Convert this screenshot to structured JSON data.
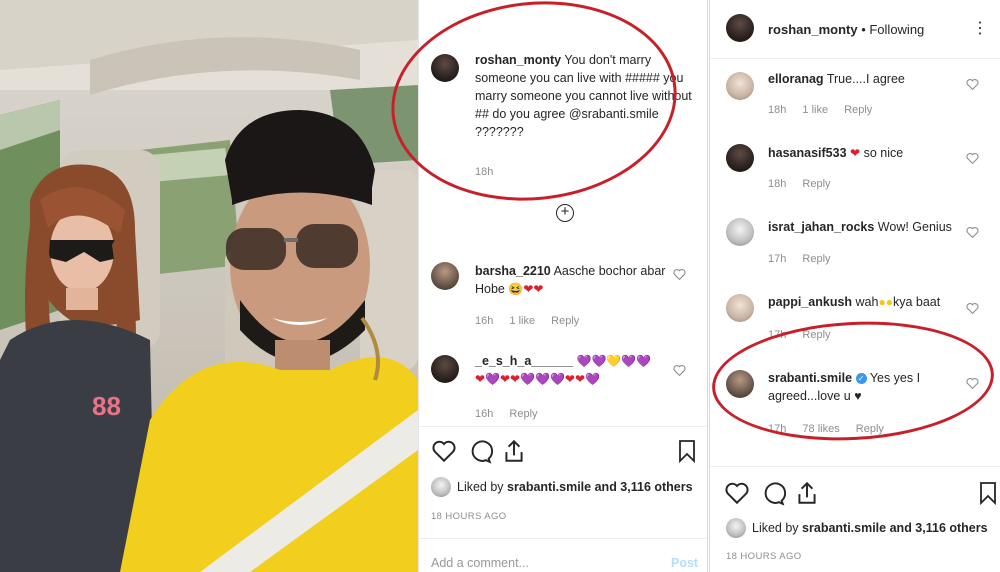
{
  "middle": {
    "top_comment": {
      "username": "roshan_monty",
      "text": "You don't marry someone you can live with ##### you marry someone you cannot live without ## do you agree",
      "mention": "@srabanti.smile",
      "trail": "???????",
      "time": "18h"
    },
    "comments": [
      {
        "username": "barsha_2210",
        "text": "Aasche bochor abar Hobe",
        "emojis": "😆❤❤",
        "time": "16h",
        "likes": "1 like",
        "reply": "Reply"
      },
      {
        "username": "_e_s_h_a______",
        "emojis_line1": "💜💜💛💜💜",
        "emojis_line2": "❤💜❤❤💜💜💜❤❤💜",
        "time": "16h",
        "reply": "Reply"
      }
    ],
    "liked_by_user": "srabanti.smile",
    "liked_by_rest": "and 3,116 others",
    "liked_prefix": "Liked by",
    "timestamp": "18 HOURS AGO",
    "add_comment_placeholder": "Add a comment...",
    "post_label": "Post"
  },
  "right": {
    "header_username": "roshan_monty",
    "header_following": "• Following",
    "comments": [
      {
        "username": "elloranag",
        "text": "True....I agree",
        "time": "18h",
        "likes": "1 like",
        "reply": "Reply"
      },
      {
        "username": "hasanasif533",
        "text": "so nice",
        "time": "18h",
        "reply": "Reply"
      },
      {
        "username": "israt_jahan_rocks",
        "text": "Wow! Genius",
        "time": "17h",
        "reply": "Reply"
      },
      {
        "username": "pappi_ankush",
        "text_a": "wah",
        "text_b": "kya baat",
        "time": "17h",
        "reply": "Reply"
      },
      {
        "username": "srabanti.smile",
        "text": "Yes yes I agreed...love u",
        "time": "17h",
        "likes": "78 likes",
        "reply": "Reply"
      }
    ],
    "liked_by_user": "srabanti.smile",
    "liked_by_rest": "and 3,116 others",
    "liked_prefix": "Liked by",
    "timestamp": "18 HOURS AGO"
  },
  "colors": {
    "annotation_red": "#c8202a",
    "like_heart_red": "#e01e2e",
    "verified_blue": "#3897f0",
    "meta_grey": "#8e8e8e"
  },
  "icons": [
    "heart-icon",
    "comment-icon",
    "share-icon",
    "bookmark-icon",
    "plus-circle-icon",
    "more-dots-icon",
    "verified-icon"
  ]
}
